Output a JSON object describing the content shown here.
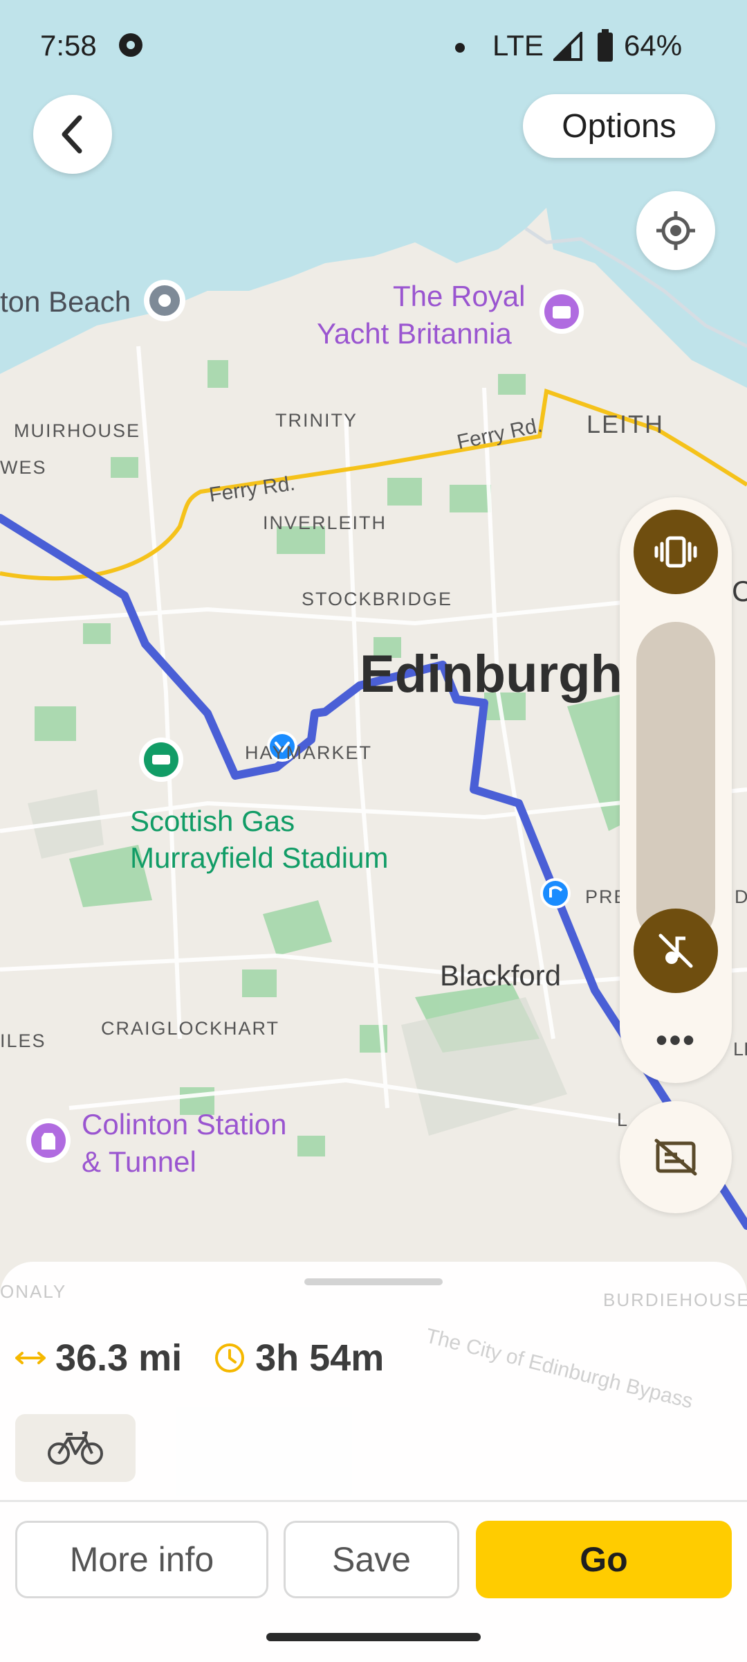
{
  "status_bar": {
    "time": "7:58",
    "network": "LTE",
    "battery": "64%"
  },
  "nav": {
    "options_label": "Options"
  },
  "map": {
    "places": {
      "beach": "ton Beach",
      "yacht_1": "The Royal",
      "yacht_2": "Yacht Britannia",
      "muirhouse": "MUIRHOUSE",
      "wes": "WES",
      "trinity": "TRINITY",
      "leith": "LEITH",
      "ferry_rd_1": "Ferry Rd.",
      "ferry_rd_2": "Ferry Rd.",
      "inverleith": "INVERLEITH",
      "stockbridge": "STOCKBRIDGE",
      "edinburgh": "Edinburgh",
      "haymarket": "HAYMARKET",
      "stadium_1": "Scottish Gas",
      "stadium_2": "Murrayfield Stadium",
      "pre": "PRE",
      "blackford": "Blackford",
      "craiglockhart": "CRAIGLOCKHART",
      "iles": "ILES",
      "colinton_1": "Colinton Station",
      "colinton_2": "& Tunnel",
      "c_edge": "C",
      "d_edge": "D",
      "li_edge": "LI",
      "l_edge": "L",
      "onaly": "ONALY",
      "burdiehouse": "BURDIEHOUSE",
      "bypass": "The City of Edinburgh Bypass"
    }
  },
  "route": {
    "distance": "36.3 mi",
    "duration": "3h 54m",
    "mode_icon": "bicycle-icon"
  },
  "actions": {
    "more_info": "More info",
    "save": "Save",
    "go": "Go"
  },
  "colors": {
    "route": "#4a5fd6",
    "accent": "#ffcc00",
    "volume": "#6f4e0f"
  }
}
